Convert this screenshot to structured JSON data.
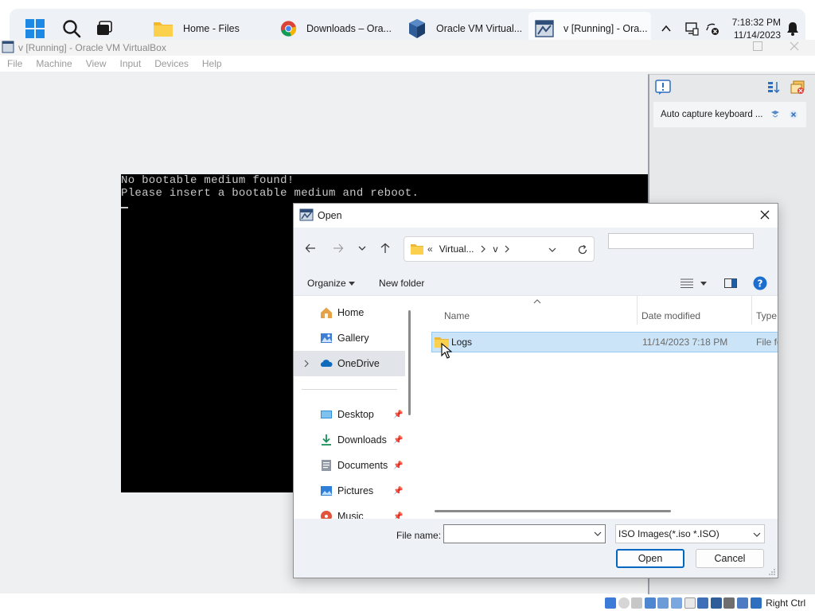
{
  "taskbar": {
    "apps": [
      {
        "label": "Home - Files",
        "icon": "folder-icon"
      },
      {
        "label": "Downloads – Ora...",
        "icon": "chrome-icon"
      },
      {
        "label": "Oracle VM Virtual...",
        "icon": "virtualbox-icon"
      },
      {
        "label": "v [Running] - Ora...",
        "icon": "vm-window-icon"
      }
    ],
    "time": "7:18:32 PM",
    "date": "11/14/2023"
  },
  "vbox": {
    "title": "v [Running] - Oracle VM VirtualBox",
    "menu": [
      "File",
      "Machine",
      "View",
      "Input",
      "Devices",
      "Help"
    ],
    "guest_lines": [
      "No bootable medium found!",
      "Please insert a bootable medium and reboot."
    ],
    "notification": "Auto capture keyboard ...",
    "host_key": "Right Ctrl"
  },
  "dialog": {
    "title": "Open",
    "address": {
      "prefix": "«",
      "segments": [
        "Virtual...",
        "v"
      ]
    },
    "search_placeholder": "",
    "organize": "Organize",
    "new_folder": "New folder",
    "nav": [
      {
        "label": "Home",
        "icon": "home-icon",
        "pinned": false
      },
      {
        "label": "Gallery",
        "icon": "gallery-icon",
        "pinned": false
      },
      {
        "label": "OneDrive",
        "icon": "onedrive-icon",
        "pinned": false
      },
      {
        "label": "Desktop",
        "icon": "desktop-icon",
        "pinned": true
      },
      {
        "label": "Downloads",
        "icon": "download-icon",
        "pinned": true
      },
      {
        "label": "Documents",
        "icon": "documents-icon",
        "pinned": true
      },
      {
        "label": "Pictures",
        "icon": "pictures-icon",
        "pinned": true
      },
      {
        "label": "Music",
        "icon": "music-icon",
        "pinned": true
      }
    ],
    "columns": {
      "name": "Name",
      "date": "Date modified",
      "type": "Type"
    },
    "files": [
      {
        "name": "Logs",
        "date": "11/14/2023 7:18 PM",
        "type": "File fo"
      }
    ],
    "file_name_label": "File name:",
    "file_name_value": "",
    "file_type": "ISO Images(*.iso *.ISO)",
    "open_label": "Open",
    "cancel_label": "Cancel"
  }
}
